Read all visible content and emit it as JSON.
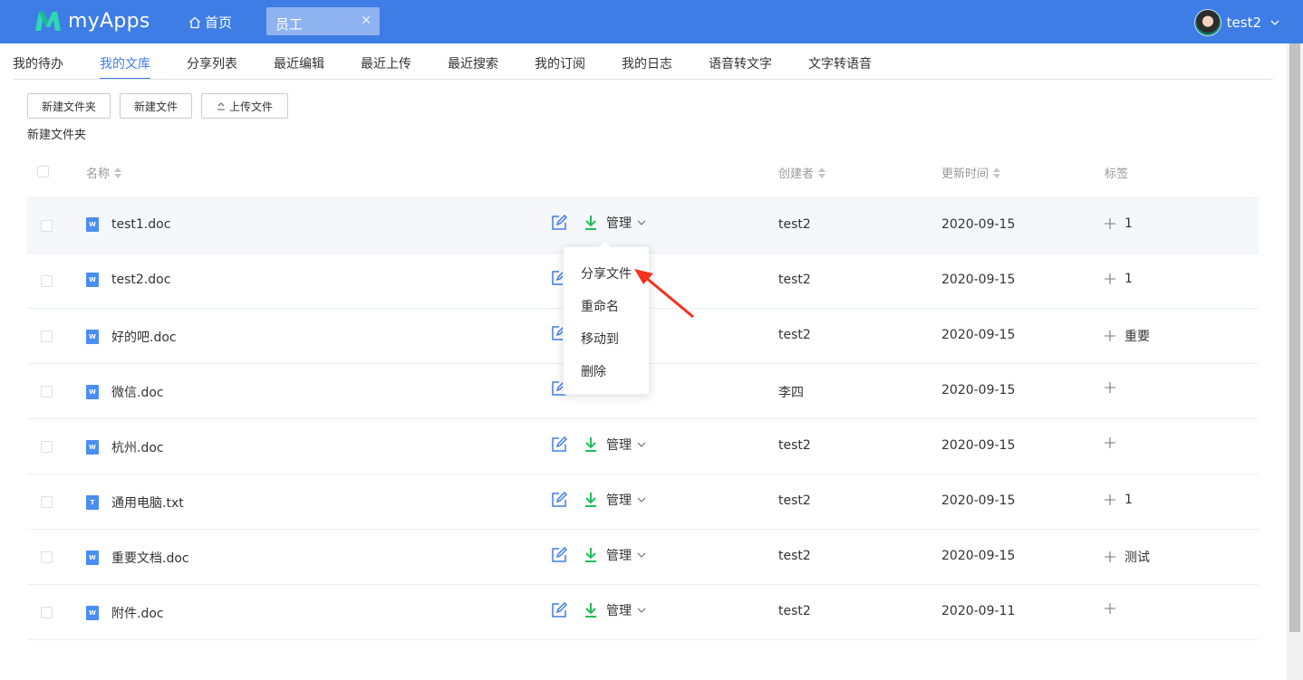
{
  "header": {
    "app_name": "myApps",
    "home_label": "首页",
    "open_tab": "员工",
    "close_glyph": "✕",
    "user_name": "test2",
    "brand_color": "#3e7de6"
  },
  "nav": {
    "tabs": [
      {
        "label": "我的待办"
      },
      {
        "label": "我的文库"
      },
      {
        "label": "分享列表"
      },
      {
        "label": "最近编辑"
      },
      {
        "label": "最近上传"
      },
      {
        "label": "最近搜索"
      },
      {
        "label": "我的订阅"
      },
      {
        "label": "我的日志"
      },
      {
        "label": "语音转文字"
      },
      {
        "label": "文字转语音"
      }
    ],
    "active_index": 1
  },
  "toolbar": {
    "new_folder": "新建文件夹",
    "new_file": "新建文件",
    "upload_file": "上传文件",
    "breadcrumb": "新建文件夹"
  },
  "table": {
    "columns": {
      "name": "名称",
      "creator": "创建者",
      "updated": "更新时间",
      "tags": "标签"
    },
    "manage_label": "管理",
    "rows": [
      {
        "name": "test1.doc",
        "type": "doc",
        "creator": "test2",
        "date": "2020-09-15",
        "tag": "1",
        "show_ops": true
      },
      {
        "name": "test2.doc",
        "type": "doc",
        "creator": "test2",
        "date": "2020-09-15",
        "tag": "1",
        "show_ops": false
      },
      {
        "name": "好的吧.doc",
        "type": "doc",
        "creator": "test2",
        "date": "2020-09-15",
        "tag": "重要",
        "show_ops": false
      },
      {
        "name": "微信.doc",
        "type": "doc",
        "creator": "李四",
        "date": "2020-09-15",
        "tag": "",
        "show_ops": false
      },
      {
        "name": "杭州.doc",
        "type": "doc",
        "creator": "test2",
        "date": "2020-09-15",
        "tag": "",
        "show_ops": true
      },
      {
        "name": "通用电脑.txt",
        "type": "txt",
        "creator": "test2",
        "date": "2020-09-15",
        "tag": "1",
        "show_ops": true
      },
      {
        "name": "重要文档.doc",
        "type": "doc",
        "creator": "test2",
        "date": "2020-09-15",
        "tag": "测试",
        "show_ops": true
      },
      {
        "name": "附件.doc",
        "type": "doc",
        "creator": "test2",
        "date": "2020-09-11",
        "tag": "",
        "show_ops": true
      }
    ]
  },
  "dropdown": {
    "items": [
      {
        "label": "分享文件"
      },
      {
        "label": "重命名"
      },
      {
        "label": "移动到"
      },
      {
        "label": "删除"
      }
    ]
  },
  "icons": {
    "doc": "W",
    "txt": "T",
    "edit_color": "#3e7de6",
    "download_color": "#1fbf5b",
    "arrow_color": "#f5311f"
  }
}
